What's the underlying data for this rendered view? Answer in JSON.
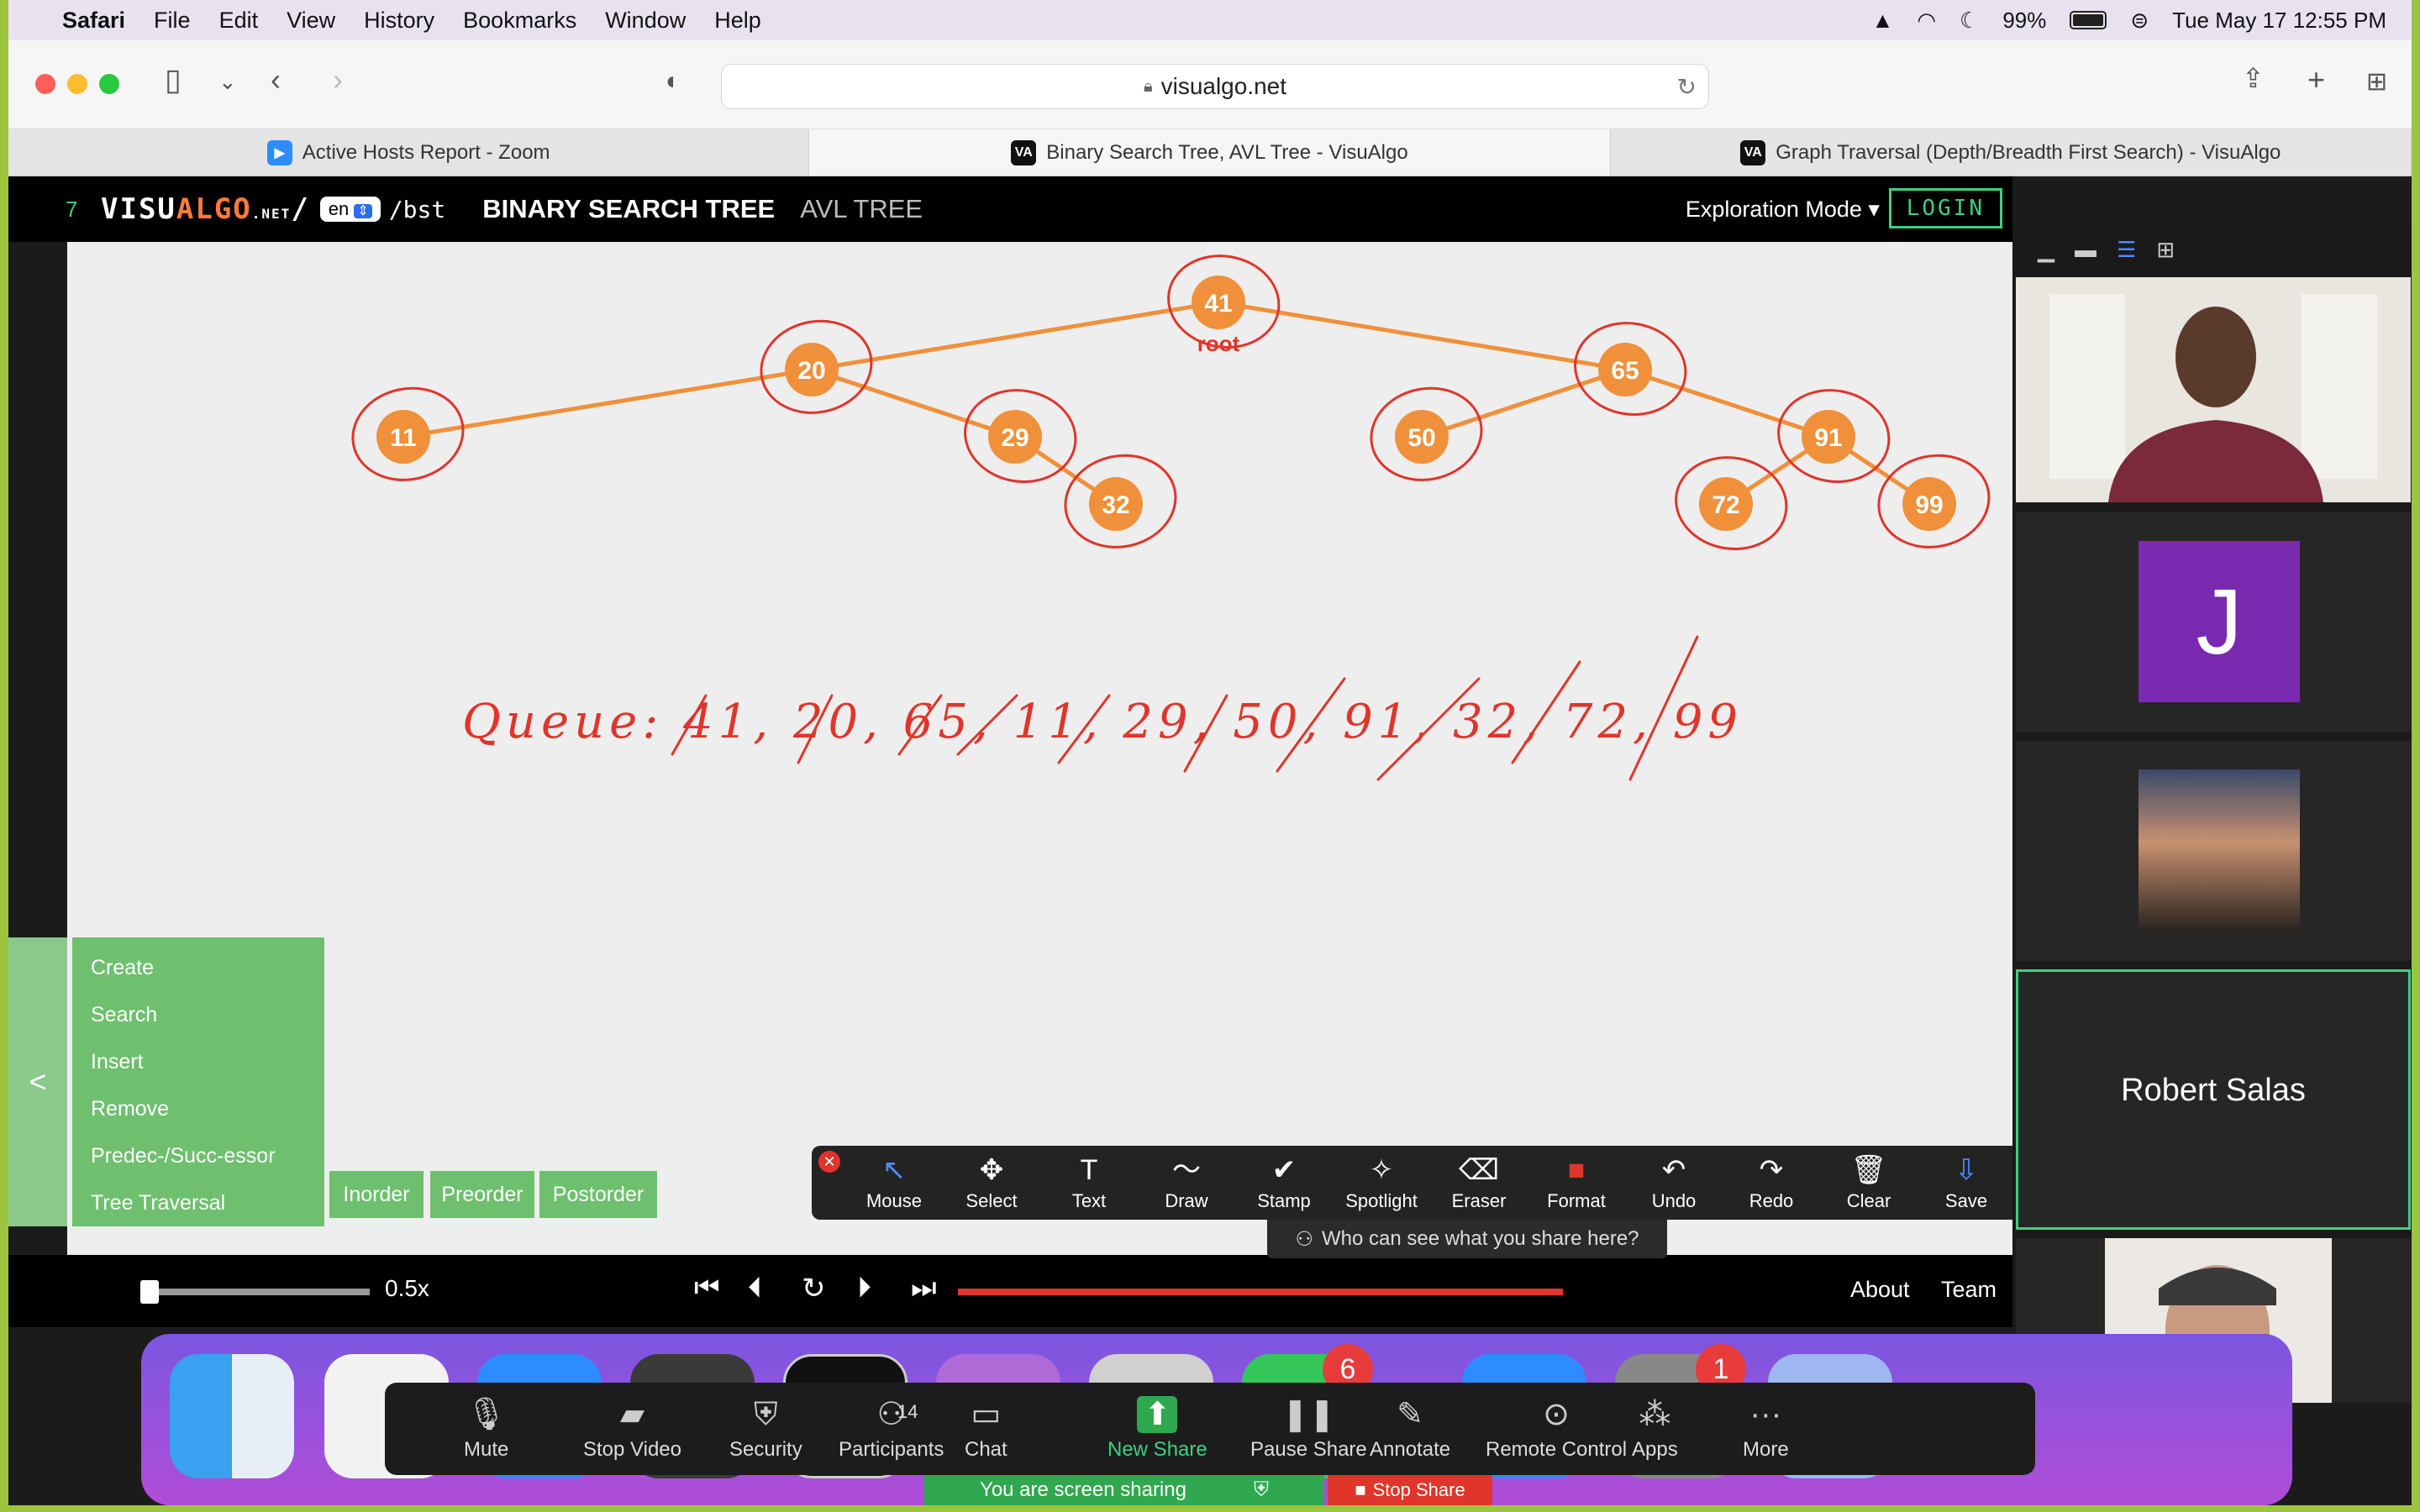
{
  "menubar": {
    "app": "Safari",
    "items": [
      "File",
      "Edit",
      "View",
      "History",
      "Bookmarks",
      "Window",
      "Help"
    ],
    "battery": "99%",
    "datetime": "Tue May 17  12:55 PM"
  },
  "toolbar": {
    "url": "visualgo.net"
  },
  "tabs": [
    {
      "label": "Active Hosts Report - Zoom"
    },
    {
      "label": "Binary Search Tree, AVL Tree - VisuAlgo"
    },
    {
      "label": "Graph Traversal (Depth/Breadth First Search) - VisuAlgo"
    }
  ],
  "visualgo": {
    "logo_visu": "VISU",
    "logo_algo": "ALGO",
    "logo_net": ".NET",
    "lang": "en",
    "path": "/bst",
    "title_primary": "BINARY SEARCH TREE",
    "title_secondary": "AVL TREE",
    "mode": "Exploration Mode ▾",
    "login": "LOGIN",
    "root_label": "root",
    "nodes": [
      "41",
      "20",
      "65",
      "11",
      "29",
      "50",
      "91",
      "32",
      "72",
      "99"
    ],
    "handwriting": "Queue: 41, 20, 65, 11, 29, 50, 91, 32, 72, 99",
    "menu": [
      "Create",
      "Search",
      "Insert",
      "Remove",
      "Predec-/Succ-essor",
      "Tree Traversal"
    ],
    "traversal_buttons": [
      "Inorder",
      "Preorder",
      "Postorder"
    ],
    "side_toggle": "<",
    "speed": "0.5x",
    "speed_fraction": 0.02,
    "progress_fraction": 1.0,
    "about": "About",
    "team": "Team"
  },
  "annotate": {
    "tools": [
      "Mouse",
      "Select",
      "Text",
      "Draw",
      "Stamp",
      "Spotlight",
      "Eraser",
      "Format",
      "Undo",
      "Redo",
      "Clear",
      "Save"
    ],
    "who_can_see": "Who can see what you share here?"
  },
  "video": {
    "avatar_letter": "J",
    "participant_name": "Robert Salas"
  },
  "zoom_controls": {
    "items": [
      "Mute",
      "Stop Video",
      "Security",
      "Participants",
      "Chat",
      "New Share",
      "Pause Share",
      "Annotate",
      "Remote Control",
      "Apps",
      "More"
    ],
    "participants_count": "14",
    "sharing_text": "You are screen sharing",
    "stop_share": "Stop Share"
  },
  "dock": {
    "badge_messages": "6",
    "badge_app": "1"
  },
  "colors": {
    "node": "#f0903a",
    "edge": "#f0903a",
    "ink": "#e0352b",
    "menu_green": "#6ec06e",
    "zoom_green": "#2fa84f"
  }
}
